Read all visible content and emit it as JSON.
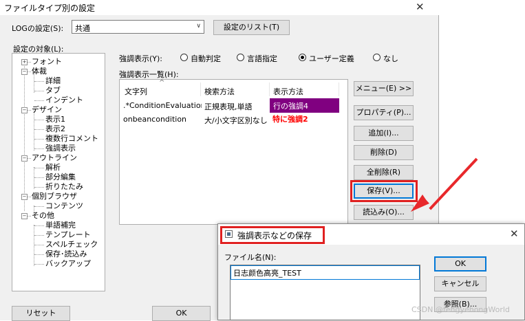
{
  "window": {
    "title": "ファイルタイプ別の設定",
    "close": "✕"
  },
  "log": {
    "label": "LOGの設定(S):",
    "value": "共通",
    "list_button": "設定のリスト(T)"
  },
  "target": {
    "label": "設定の対象(L):",
    "tree": [
      {
        "label": "フォント",
        "toggle": "+"
      },
      {
        "label": "体裁",
        "toggle": "−"
      },
      {
        "label": "詳細"
      },
      {
        "label": "タブ"
      },
      {
        "label": "インデント"
      },
      {
        "label": "デザイン",
        "toggle": "−"
      },
      {
        "label": "表示1"
      },
      {
        "label": "表示2"
      },
      {
        "label": "複数行コメント"
      },
      {
        "label": "強調表示"
      },
      {
        "label": "アウトライン",
        "toggle": "−"
      },
      {
        "label": "解析"
      },
      {
        "label": "部分編集"
      },
      {
        "label": "折りたたみ"
      },
      {
        "label": "個別ブラウザ",
        "toggle": "−"
      },
      {
        "label": "コンテンツ"
      },
      {
        "label": "その他",
        "toggle": "−"
      },
      {
        "label": "単語補完"
      },
      {
        "label": "テンプレート"
      },
      {
        "label": "スペルチェック"
      },
      {
        "label": "保存･読込み"
      },
      {
        "label": "バックアップ"
      }
    ]
  },
  "highlight_display": {
    "label": "強調表示(Y):",
    "options": [
      {
        "label": "自動判定",
        "selected": false
      },
      {
        "label": "言語指定",
        "selected": false
      },
      {
        "label": "ユーザー定義",
        "selected": true
      },
      {
        "label": "なし",
        "selected": false
      }
    ]
  },
  "highlight_list": {
    "label": "強調表示一覧(H):",
    "columns": [
      "文字列",
      "検索方法",
      "表示方法"
    ],
    "sort_indicator": "^",
    "rows": [
      {
        "string": ".*ConditionEvaluationI",
        "method": "正規表現,単語",
        "display": "行の強調4"
      },
      {
        "string": "onbeancondition",
        "method": "大/小文字区別なし",
        "display": "特に強調2"
      }
    ]
  },
  "side_buttons": {
    "menu": "メニュー(E) >>",
    "properties": "プロパティ(P)...",
    "add": "追加(I)...",
    "delete": "削除(D)",
    "delete_all": "全削除(R)",
    "save": "保存(V)...",
    "load": "読込み(O)..."
  },
  "bottom_buttons": {
    "reset": "リセット",
    "ok": "OK"
  },
  "save_dialog": {
    "title": "強調表示などの保存",
    "close": "✕",
    "file_label": "ファイル名(N):",
    "file_value": "日志颜色高亮_TEST",
    "ok": "OK",
    "cancel": "キャンセル",
    "browse": "参照(B)..."
  },
  "watermark": "CSDN @fengyehongWorld",
  "colors": {
    "row1_display_bg": "#800080",
    "row2_display_text": "#ff0000",
    "annotation_red": "#e02020",
    "focus_blue": "#0078d7"
  }
}
